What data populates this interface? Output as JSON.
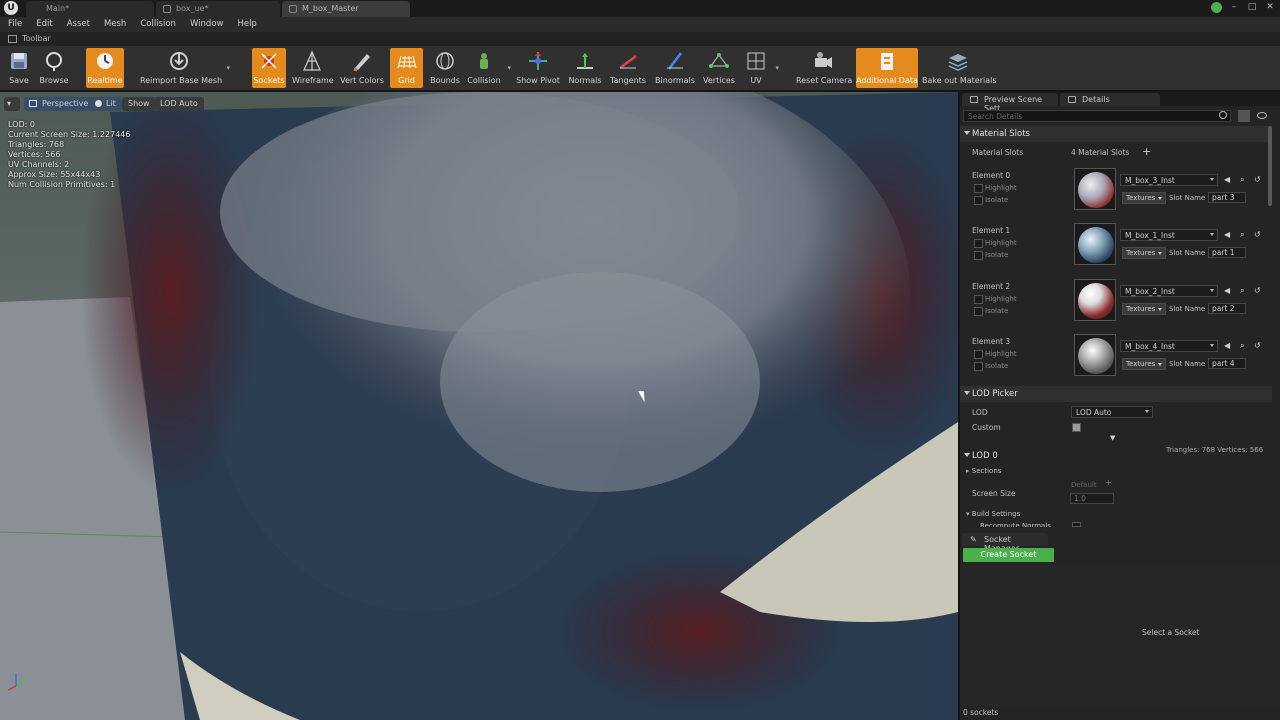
{
  "window": {
    "tabs": [
      {
        "label": "Main*",
        "active": false
      },
      {
        "label": "box_ue*",
        "active": false
      },
      {
        "label": "M_box_Master",
        "active": true
      }
    ]
  },
  "menu": [
    "File",
    "Edit",
    "Asset",
    "Mesh",
    "Collision",
    "Window",
    "Help"
  ],
  "toolbar_title": "Toolbar",
  "toolbar": [
    {
      "label": "Save",
      "icon": "save-icon",
      "active": false
    },
    {
      "label": "Browse",
      "icon": "browse-icon",
      "active": false
    },
    {
      "label": "Realtime",
      "icon": "realtime-icon",
      "active": true
    },
    {
      "label": "Reimport Base Mesh",
      "icon": "reimport-icon",
      "active": false
    },
    {
      "label": "Sockets",
      "icon": "sockets-icon",
      "active": true
    },
    {
      "label": "Wireframe",
      "icon": "wireframe-icon",
      "active": false
    },
    {
      "label": "Vert Colors",
      "icon": "vert-colors-icon",
      "active": false
    },
    {
      "label": "Grid",
      "icon": "grid-icon",
      "active": true
    },
    {
      "label": "Bounds",
      "icon": "bounds-icon",
      "active": false
    },
    {
      "label": "Collision",
      "icon": "collision-icon",
      "active": false
    },
    {
      "label": "Show Pivot",
      "icon": "pivot-icon",
      "active": false
    },
    {
      "label": "Normals",
      "icon": "normals-icon",
      "active": false
    },
    {
      "label": "Tangents",
      "icon": "tangents-icon",
      "active": false
    },
    {
      "label": "Binormals",
      "icon": "binormals-icon",
      "active": false
    },
    {
      "label": "Vertices",
      "icon": "vertices-icon",
      "active": false
    },
    {
      "label": "UV",
      "icon": "uv-icon",
      "active": false
    },
    {
      "label": "Reset Camera",
      "icon": "camera-icon",
      "active": false
    },
    {
      "label": "Additional Data",
      "icon": "additional-data-icon",
      "active": true
    },
    {
      "label": "Bake out Materials",
      "icon": "bake-icon",
      "active": false
    }
  ],
  "viewport": {
    "buttons": {
      "perspective": "Perspective",
      "lit": "Lit",
      "show": "Show",
      "lod": "LOD Auto"
    },
    "stats": [
      "LOD: 0",
      "Current Screen Size: 1.227446",
      "Triangles: 768",
      "Vertices: 566",
      "UV Channels: 2",
      "Approx Size: 55x44x43",
      "Num Collision Primitives: 1"
    ]
  },
  "panel": {
    "tabs": {
      "preview": "Preview Scene Sett",
      "details": "Details"
    },
    "search_placeholder": "Search Details",
    "material_slots": {
      "header": "Material Slots",
      "label": "Material Slots",
      "count": "4 Material Slots",
      "highlight": "Highlight",
      "isolate": "Isolate",
      "textures": "Textures",
      "slot_name_label": "Slot Name",
      "elements": [
        {
          "label": "Element 0",
          "material": "M_box_3_Inst",
          "slot": "part 3"
        },
        {
          "label": "Element 1",
          "material": "M_box_1_Inst",
          "slot": "part 1"
        },
        {
          "label": "Element 2",
          "material": "M_box_2_Inst",
          "slot": "part 2"
        },
        {
          "label": "Element 3",
          "material": "M_box_4_Inst",
          "slot": "part 4"
        }
      ]
    },
    "lod_picker": {
      "header": "LOD Picker",
      "lod_label": "LOD",
      "lod_value": "LOD Auto",
      "custom_label": "Custom"
    },
    "tri_info": "Triangles: 768  Vertices: 566",
    "lod0": {
      "header": "LOD 0",
      "sections": "Sections",
      "screen_size_label": "Screen Size",
      "default_label": "Default",
      "screen_size_value": "1.0",
      "build_settings": "Build Settings",
      "recompute": "Recompute Normals"
    },
    "socket_manager": {
      "title": "Socket Manager",
      "create_button": "Create Socket",
      "select_text": "Select a Socket",
      "count": "0 sockets"
    }
  },
  "colors": {
    "accent": "#e58a1c",
    "create_socket": "#4bb04b"
  }
}
